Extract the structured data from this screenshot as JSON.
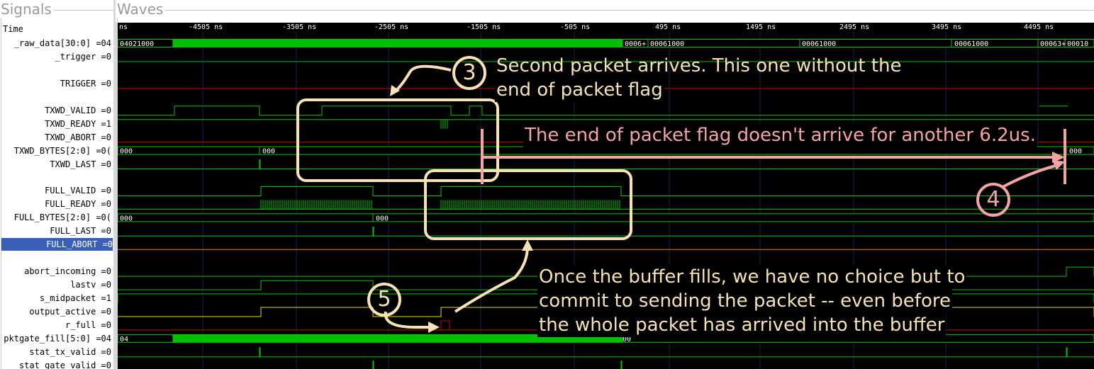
{
  "panels": {
    "signals_title": "Signals",
    "waves_title": "Waves"
  },
  "time_header": "Time",
  "ruler": {
    "labels": [
      "ns",
      "-4505 ns",
      "-3505 ns",
      "-2505 ns",
      "-1505 ns",
      "-505 ns",
      "495 ns",
      "1495 ns",
      "2495 ns",
      "3495 ns",
      "4495 ns"
    ]
  },
  "signals": [
    {
      "name": "_raw_data[30:0] =04",
      "selected": false
    },
    {
      "name": "_trigger =0",
      "selected": false
    },
    {
      "name": "",
      "selected": false
    },
    {
      "name": "TRIGGER =0",
      "selected": false
    },
    {
      "name": "",
      "selected": false
    },
    {
      "name": "TXWD_VALID =0",
      "selected": false
    },
    {
      "name": "TXWD_READY =1",
      "selected": false
    },
    {
      "name": "TXWD_ABORT =0",
      "selected": false
    },
    {
      "name": "TXWD_BYTES[2:0] =0(",
      "selected": false
    },
    {
      "name": "TXWD_LAST =0",
      "selected": false
    },
    {
      "name": "",
      "selected": false
    },
    {
      "name": "FULL_VALID =0",
      "selected": false
    },
    {
      "name": "FULL_READY =0",
      "selected": false
    },
    {
      "name": "FULL_BYTES[2:0] =0(",
      "selected": false
    },
    {
      "name": "FULL_LAST =0",
      "selected": false
    },
    {
      "name": "FULL_ABORT =0",
      "selected": true
    },
    {
      "name": "",
      "selected": false
    },
    {
      "name": "abort_incoming =0",
      "selected": false
    },
    {
      "name": "lastv =0",
      "selected": false
    },
    {
      "name": "s_midpacket =1",
      "selected": false
    },
    {
      "name": "output_active =0",
      "selected": false
    },
    {
      "name": "r_full =0",
      "selected": false
    },
    {
      "name": "pktgate_fill[5:0] =04",
      "selected": false
    },
    {
      "name": "stat_tx_valid =0",
      "selected": false
    },
    {
      "name": "stat_gate_valid =0",
      "selected": false
    }
  ],
  "bus_values": {
    "raw_data": [
      "04021000",
      "0006+",
      "00061000",
      "00061000",
      "00061000",
      "00063+",
      "00010"
    ],
    "txwd_bytes": [
      "000",
      "000",
      "000"
    ],
    "full_bytes": [
      "000",
      "000"
    ],
    "pktgate_fill": [
      "04",
      "00"
    ]
  },
  "annotations": {
    "a3_number": "3",
    "a3_text_line1": "Second packet arrives.  This one without the",
    "a3_text_line2": "end of packet flag",
    "a_eop_text": "The end of packet flag doesn't arrive for another 6.2us.",
    "a4_number": "4",
    "a5_number": "5",
    "a5_text_line1": "Once the buffer fills, we have no choice but to",
    "a5_text_line2": "commit to sending the packet -- even before",
    "a5_text_line3": "the whole packet has arrived into the buffer"
  },
  "colors": {
    "wave_green": "#00c800",
    "bus_fill": "#00c000",
    "red_wave": "#d00000",
    "yellow_wave": "#e0e000",
    "orange_wave": "#f08000",
    "grid_blue": "#1b1b5a",
    "annot_cream": "#f6e2b4",
    "annot_pink": "#f2a3a3",
    "selection_blue": "#3a5fb7"
  }
}
